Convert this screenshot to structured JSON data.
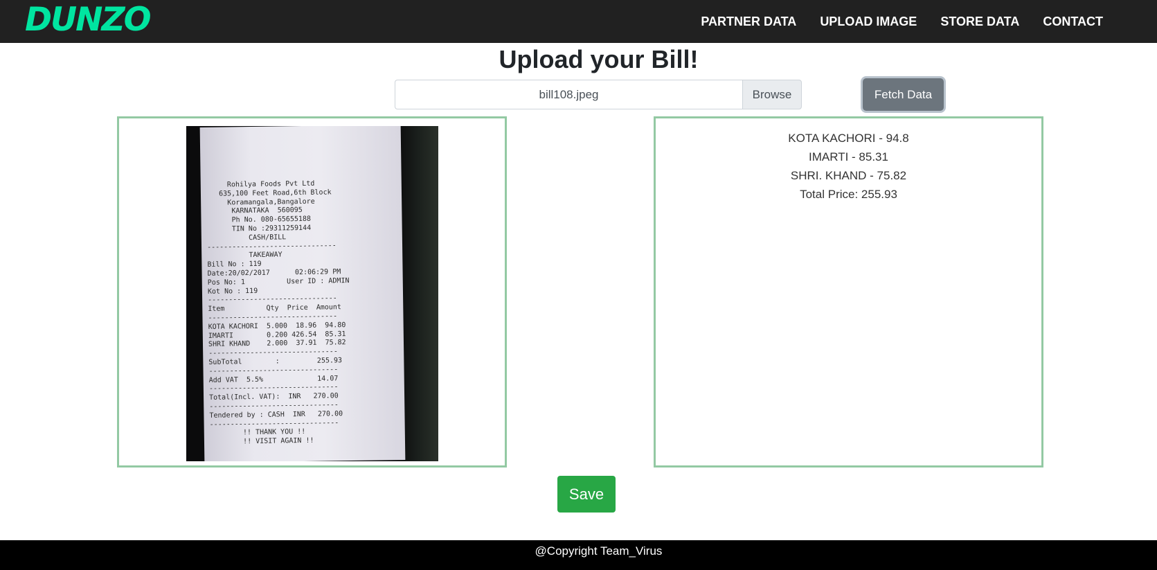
{
  "brand": {
    "logo_text": "DUNZO"
  },
  "nav": {
    "links": [
      "PARTNER DATA",
      "UPLOAD IMAGE",
      "STORE DATA",
      "CONTACT"
    ]
  },
  "page": {
    "title": "Upload your Bill!"
  },
  "upload": {
    "file_name": "bill108.jpeg",
    "browse_label": "Browse",
    "fetch_label": "Fetch Data"
  },
  "receipt": {
    "lines": [
      "     Rohilya Foods Pvt Ltd",
      "   635,100 Feet Road,6th Block",
      "     Koramangala,Bangalore",
      "      KARNATAKA  560095",
      "      Ph No. 080-65655188",
      "      TIN No :29311259144",
      "          CASH/BILL",
      "-------------------------------",
      "          TAKEAWAY",
      "Bill No : 119",
      "Date:20/02/2017      02:06:29 PM",
      "Pos No: 1          User ID : ADMIN",
      "Kot No : 119",
      "-------------------------------",
      "Item          Qty  Price  Amount",
      "-------------------------------",
      "KOTA KACHORI  5.000  18.96  94.80",
      "IMARTI        0.200 426.54  85.31",
      "SHRI KHAND    2.000  37.91  75.82",
      "-------------------------------",
      "SubTotal        :         255.93",
      "-------------------------------",
      "Add VAT  5.5%             14.07",
      "-------------------------------",
      "Total(Incl. VAT):  INR   270.00",
      "-------------------------------",
      "Tendered by : CASH  INR   270.00",
      "-------------------------------",
      "        !! THANK YOU !!",
      "        !! VISIT AGAIN !!"
    ]
  },
  "results": {
    "items": [
      "KOTA KACHORI - 94.8",
      "IMARTI - 85.31",
      "SHRI. KHAND - 75.82",
      "Total Price: 255.93"
    ]
  },
  "actions": {
    "save_label": "Save"
  },
  "footer": {
    "text": "@Copyright Team_Virus"
  },
  "colors": {
    "navbar": "#212121",
    "brand_green": "#00e5a0",
    "panel_border": "#93c9a3",
    "fetch_button": "#6c757d",
    "save_button": "#28a745",
    "footer": "#000000"
  }
}
